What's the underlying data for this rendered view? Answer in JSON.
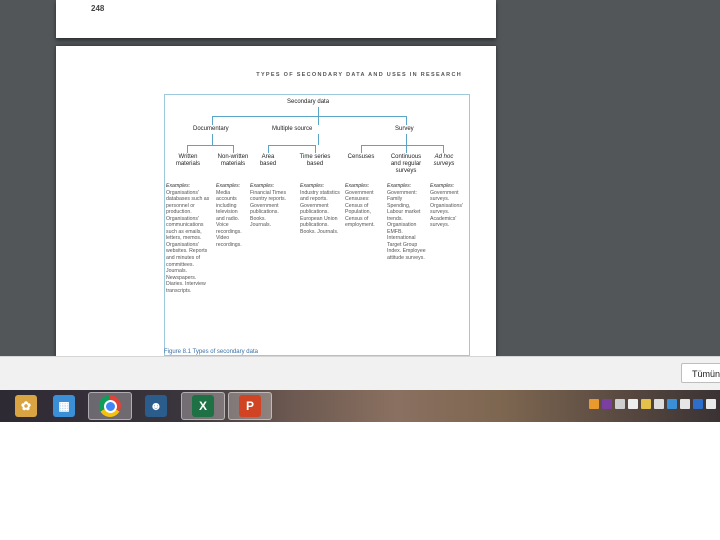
{
  "document": {
    "page_number": "248",
    "running_head": "TYPES OF SECONDARY DATA AND USES IN RESEARCH",
    "figure": {
      "root": "Secondary data",
      "groups": [
        "Documentary",
        "Multiple source",
        "Survey"
      ],
      "subtypes": [
        "Written materials",
        "Non-written materials",
        "Area based",
        "Time series based",
        "Censuses",
        "Continuous and regular surveys",
        "Ad hoc surveys"
      ],
      "examples": [
        {
          "head": "Examples:",
          "text": "Organisations' databases such as personnel or production. Organisations' communications such as emails, letters, memos. Organisations' websites. Reports and minutes of committees. Journals. Newspapers. Diaries. Interview transcripts."
        },
        {
          "head": "Examples:",
          "text": "Media accounts including television and radio. Voice recordings. Video recordings."
        },
        {
          "head": "Examples:",
          "text": "Financial Times country reports. Government publications. Books. Journals."
        },
        {
          "head": "Examples:",
          "text": "Industry statistics and reports. Government publications. European Union publications. Books. Journals."
        },
        {
          "head": "Examples:",
          "text": "Government Censuses: Census of Population, Census of employment."
        },
        {
          "head": "Examples:",
          "text": "Government: Family Spending, Labour market trends. Organisation EMFB. International Target Group Index. Employee attitude surveys."
        },
        {
          "head": "Examples:",
          "text": "Government surveys. Organisations' surveys. Academics' surveys."
        }
      ],
      "caption": "Figure 8.1  Types of secondary data"
    }
  },
  "notification": {
    "button_label": "Tümün"
  },
  "taskbar": {
    "apps": [
      {
        "icon": "paint-palette-icon",
        "color": "#d9a441"
      },
      {
        "icon": "control-panel-icon",
        "color": "#3b8fd6"
      },
      {
        "icon": "chrome-icon",
        "color": "#db4437",
        "active": true
      },
      {
        "icon": "avatar-icon",
        "color": "#2b5d8c"
      },
      {
        "icon": "excel-icon",
        "color": "#1e7145",
        "active": true
      },
      {
        "icon": "powerpoint-icon",
        "color": "#d04423",
        "active": true
      }
    ],
    "tray": [
      "app-icon",
      "onenote-icon",
      "display-icon",
      "flag-icon",
      "pen-icon",
      "battery-icon",
      "network-icon",
      "signal-icon",
      "bluetooth-icon",
      "volume-icon"
    ]
  }
}
